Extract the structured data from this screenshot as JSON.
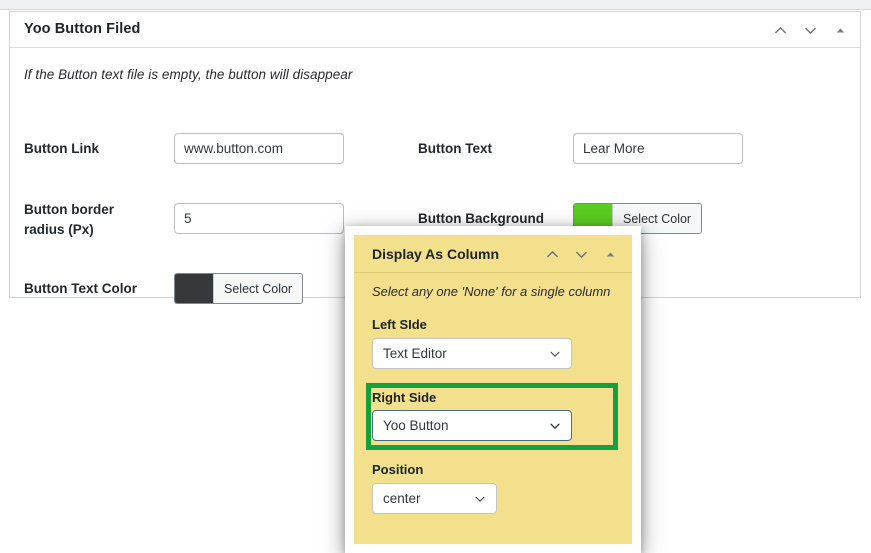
{
  "metabox": {
    "title": "Yoo Button Filed",
    "hint": "If the Button text file is empty, the button will disappear",
    "header_icons": [
      {
        "name": "chevron-up-icon",
        "glyph": "up"
      },
      {
        "name": "chevron-down-icon",
        "glyph": "down"
      },
      {
        "name": "toggle-panel-icon",
        "glyph": "triangle-up"
      }
    ],
    "fields": {
      "button_link": {
        "label": "Button Link",
        "value": "www.button.com",
        "placeholder": ""
      },
      "button_text": {
        "label": "Button Text",
        "value": "Lear More",
        "placeholder": ""
      },
      "button_border_radius": {
        "label": "Button border radius (Px)",
        "label_line1": "Button border",
        "label_line2": "radius (Px)",
        "value": "5",
        "placeholder": ""
      },
      "button_background": {
        "label": "Button Background",
        "button_label": "Select Color",
        "color": "#5bcc22"
      },
      "button_text_color": {
        "label": "Button Text Color",
        "button_label": "Select Color",
        "color": "#35393c"
      }
    }
  },
  "panel": {
    "title": "Display As Column",
    "hint": "Select any one 'None' for a single column",
    "background_color": "#f2e08c",
    "header_icons": [
      {
        "name": "chevron-up-icon",
        "glyph": "up"
      },
      {
        "name": "chevron-down-icon",
        "glyph": "down"
      },
      {
        "name": "toggle-panel-icon",
        "glyph": "triangle-up"
      }
    ],
    "left_side": {
      "label": "Left SIde",
      "value": "Text Editor"
    },
    "right_side": {
      "label": "Right Side",
      "value": "Yoo Button",
      "highlighted": true,
      "highlight_color": "#14a03b"
    },
    "position": {
      "label": "Position",
      "value": "center"
    }
  }
}
